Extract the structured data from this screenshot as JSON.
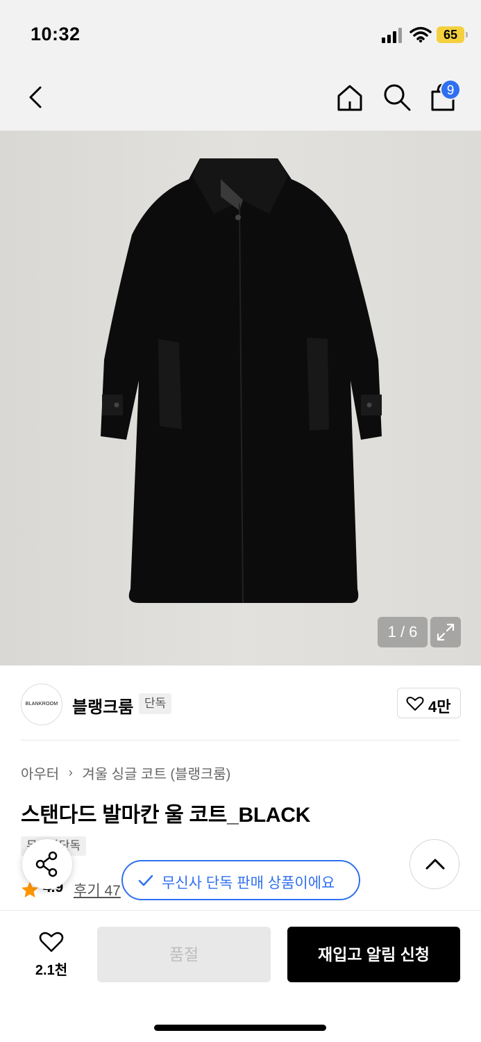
{
  "status_bar": {
    "time": "10:32",
    "battery": "65"
  },
  "header": {
    "cart_count": "9"
  },
  "gallery": {
    "counter": "1 / 6"
  },
  "brand": {
    "logo_text": "BLANKROOM",
    "name": "블랭크룸",
    "tag": "단독",
    "likes": "4만"
  },
  "breadcrumb": {
    "category": "아우터",
    "subcategory": "겨울 싱글 코트 (블랭크룸)"
  },
  "product": {
    "title": "스탠다드 발마칸 울 코트_BLACK",
    "tag": "무신사단독",
    "rating": "4.9",
    "reviews": "후기 47"
  },
  "toast": {
    "text": "무신사 단독 판매 상품이에요"
  },
  "bottom": {
    "wish_count": "2.1천",
    "soldout_label": "품절",
    "restock_label": "재입고 알림 신청"
  },
  "colors": {
    "accent": "#2f6ff0",
    "battery": "#f4d03f",
    "star": "#ff9500"
  }
}
